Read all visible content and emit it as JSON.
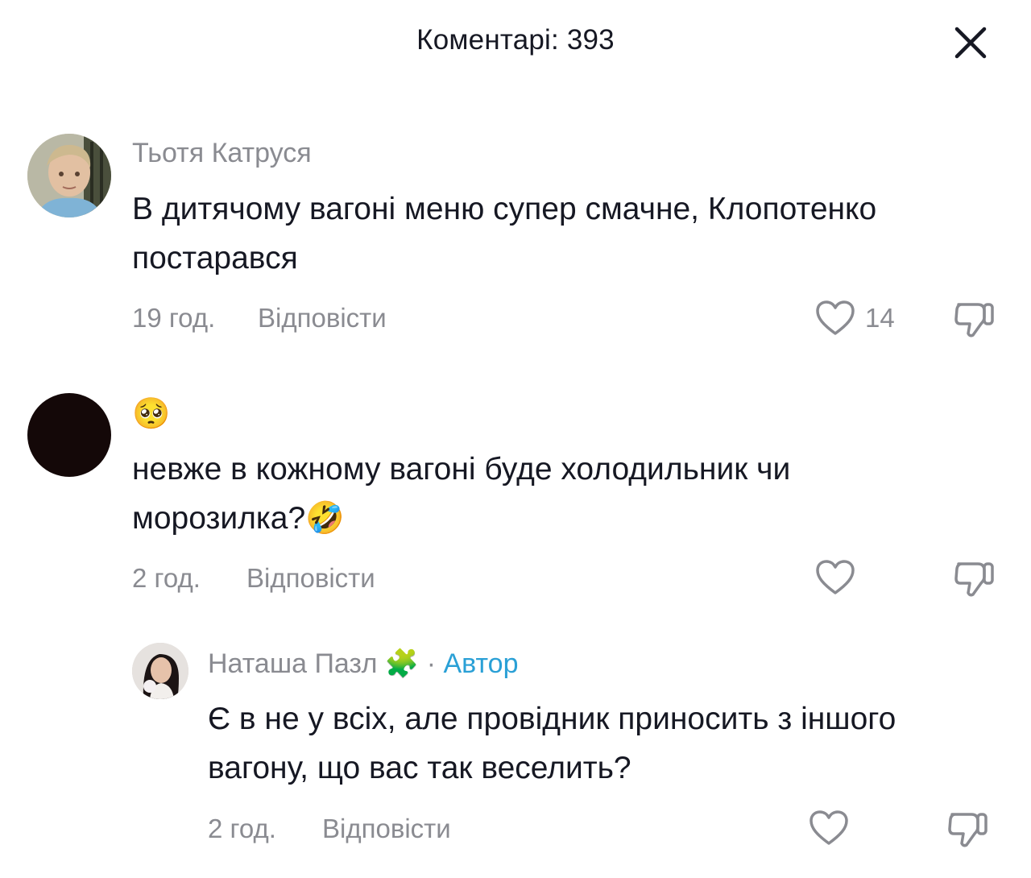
{
  "header": {
    "title": "Коментарі: 393"
  },
  "comments": [
    {
      "username": "Тьотя Катруся",
      "text": "В дитячому вагоні меню супер смачне, Клопотенко постарався",
      "time": "19 год.",
      "reply_label": "Відповісти",
      "likes": "14"
    },
    {
      "username": "🥺",
      "text": "невже в кожному вагоні буде холодильник чи морозилка?🤣",
      "time": "2 год.",
      "reply_label": "Відповісти",
      "likes": ""
    }
  ],
  "reply": {
    "username": "Наташа Пазл 🧩",
    "separator": "·",
    "author_label": "Автор",
    "text": "Є в не у всіх, але провідник приносить з іншого вагону, що вас так веселить?",
    "time": "2 год.",
    "reply_label": "Відповісти",
    "likes": ""
  },
  "colors": {
    "text_primary": "#161823",
    "text_secondary": "#8a8b91",
    "author_accent": "#2aa0d6"
  },
  "icons": {
    "close": "close-icon",
    "like": "heart-outline-icon",
    "dislike": "thumbs-down-icon"
  }
}
